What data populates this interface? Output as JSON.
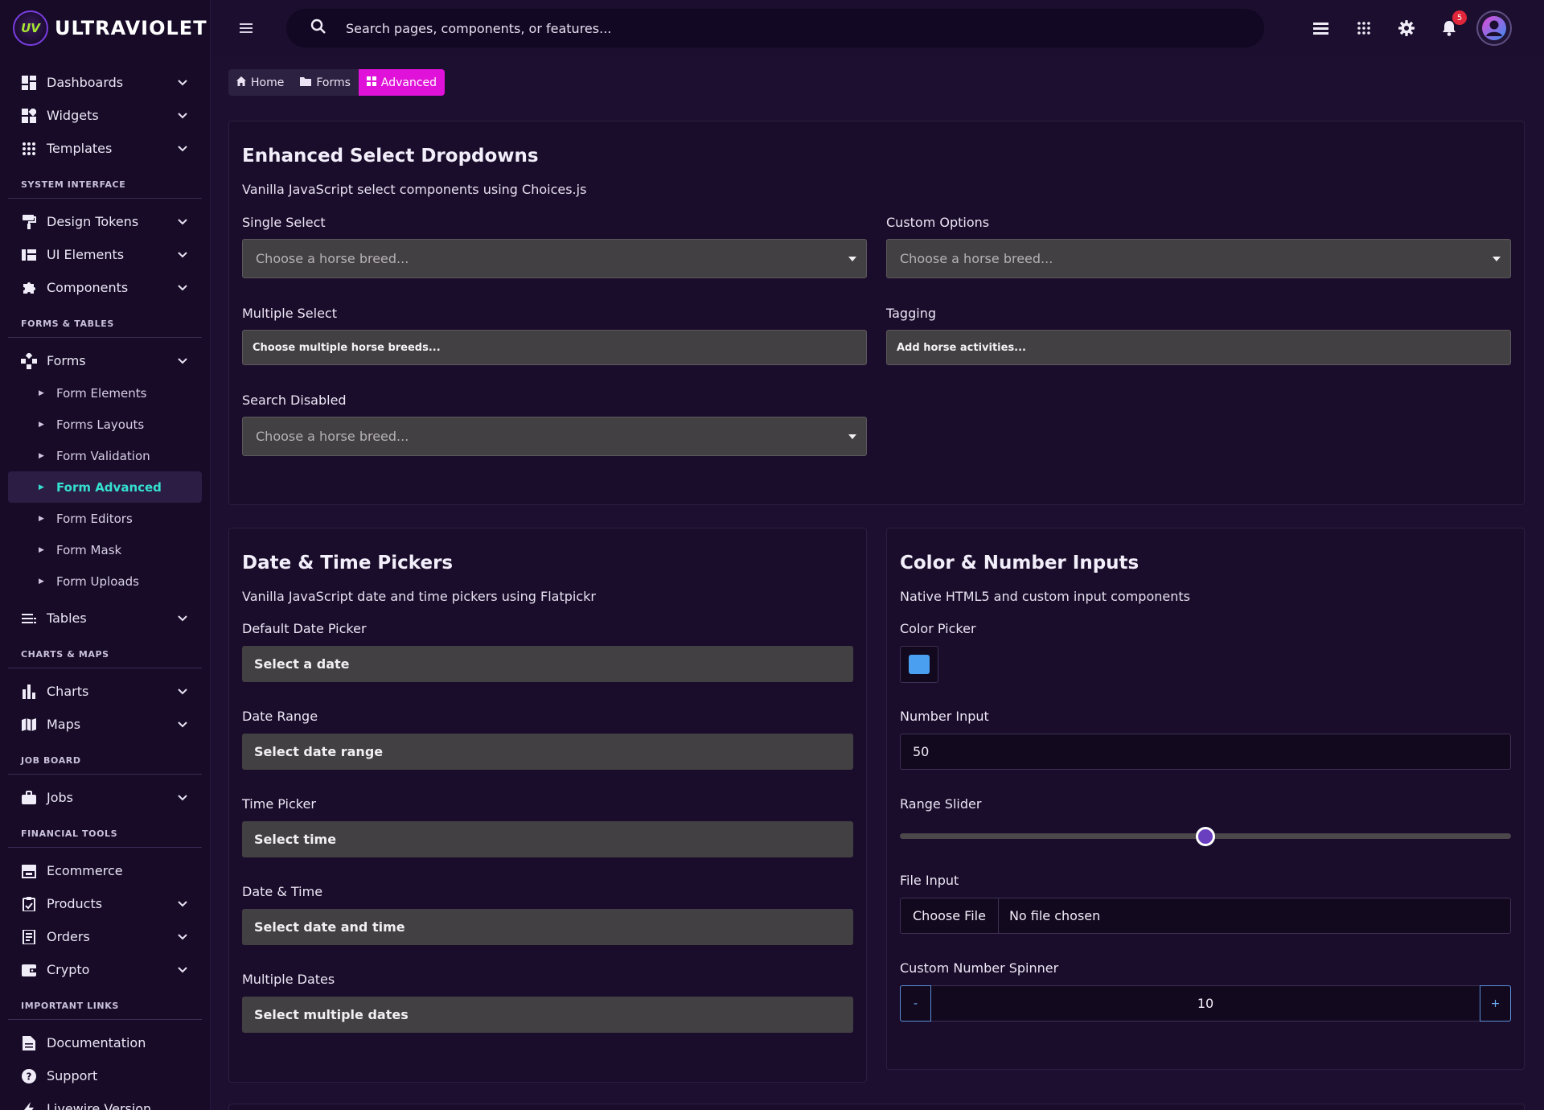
{
  "brand": {
    "logo_text": "UV",
    "name": "ULTRAVIOLET"
  },
  "sidebar": {
    "top_items": [
      {
        "label": "Dashboards",
        "icon": "dashboard-icon"
      },
      {
        "label": "Widgets",
        "icon": "widgets-icon"
      },
      {
        "label": "Templates",
        "icon": "grid-icon"
      }
    ],
    "system_interface": {
      "title": "SYSTEM INTERFACE",
      "items": [
        {
          "label": "Design Tokens",
          "icon": "paint-roller-icon"
        },
        {
          "label": "UI Elements",
          "icon": "ui-elements-icon"
        },
        {
          "label": "Components",
          "icon": "puzzle-icon"
        }
      ]
    },
    "forms_tables": {
      "title": "FORMS & TABLES",
      "forms_label": "Forms",
      "sub_items": [
        "Form Elements",
        "Forms Layouts",
        "Form Validation",
        "Form Advanced",
        "Form Editors",
        "Form Mask",
        "Form Uploads"
      ],
      "tables_label": "Tables"
    },
    "charts_maps": {
      "title": "CHARTS & MAPS",
      "items": [
        "Charts",
        "Maps"
      ]
    },
    "job_board": {
      "title": "JOB BOARD",
      "items": [
        "Jobs"
      ]
    },
    "financial_tools": {
      "title": "FINANCIAL TOOLS",
      "items": [
        "Ecommerce",
        "Products",
        "Orders",
        "Crypto"
      ]
    },
    "important_links": {
      "title": "IMPORTANT LINKS",
      "items": [
        "Documentation",
        "Support",
        "Livewire Version"
      ]
    }
  },
  "topbar": {
    "search_placeholder": "Search pages, components, or features...",
    "notification_count": "5"
  },
  "breadcrumb": {
    "home": "Home",
    "forms": "Forms",
    "current": "Advanced"
  },
  "select_card": {
    "title": "Enhanced Select Dropdowns",
    "subtitle": "Vanilla JavaScript select components using Choices.js",
    "single_label": "Single Select",
    "single_placeholder": "Choose a horse breed...",
    "custom_label": "Custom Options",
    "custom_placeholder": "Choose a horse breed...",
    "multiple_label": "Multiple Select",
    "multiple_placeholder": "Choose multiple horse breeds...",
    "tagging_label": "Tagging",
    "tagging_placeholder": "Add horse activities...",
    "search_disabled_label": "Search Disabled",
    "search_disabled_placeholder": "Choose a horse breed..."
  },
  "date_card": {
    "title": "Date & Time Pickers",
    "subtitle": "Vanilla JavaScript date and time pickers using Flatpickr",
    "fields": [
      {
        "label": "Default Date Picker",
        "placeholder": "Select a date"
      },
      {
        "label": "Date Range",
        "placeholder": "Select date range"
      },
      {
        "label": "Time Picker",
        "placeholder": "Select time"
      },
      {
        "label": "Date & Time",
        "placeholder": "Select date and time"
      },
      {
        "label": "Multiple Dates",
        "placeholder": "Select multiple dates"
      }
    ]
  },
  "color_card": {
    "title": "Color & Number Inputs",
    "subtitle": "Native HTML5 and custom input components",
    "color_label": "Color Picker",
    "color_value": "#4a9ff0",
    "number_label": "Number Input",
    "number_value": "50",
    "range_label": "Range Slider",
    "range_value": 50,
    "file_label": "File Input",
    "file_button": "Choose File",
    "file_status": "No file chosen",
    "spinner_label": "Custom Number Spinner",
    "spinner_minus": "-",
    "spinner_value": "10",
    "spinner_plus": "+"
  },
  "colors": {
    "accent_magenta": "#e011d8",
    "active_teal": "#35e0d0",
    "slider_thumb": "#6a3fbf",
    "badge_red": "#e0263a"
  }
}
